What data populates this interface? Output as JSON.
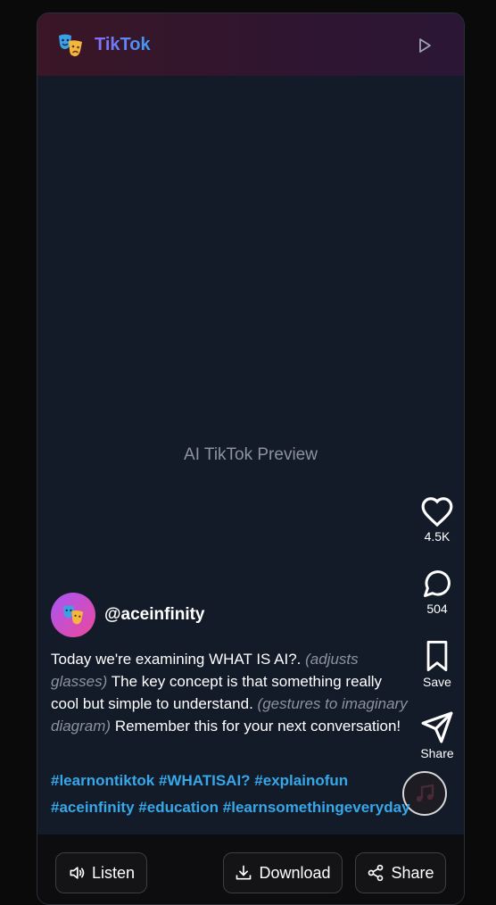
{
  "header": {
    "app_title": "TikTok",
    "logo_icon": "theater-masks-icon",
    "play_icon": "play-icon"
  },
  "video": {
    "placeholder": "AI TikTok Preview"
  },
  "actions": {
    "like_count": "4.5K",
    "comment_count": "504",
    "save_label": "Save",
    "share_label": "Share"
  },
  "author": {
    "username": "@aceinfinity"
  },
  "caption": {
    "part1": "Today we're examining WHAT IS AI?. ",
    "dir1": "(adjusts glasses)",
    "part2": " The key concept is that something really cool but simple to understand. ",
    "dir2": "(gestures to imaginary diagram)",
    "part3": " Remember this for your next conversation!"
  },
  "hashtags": [
    "#learnontiktok",
    "#WHATISAI?",
    "#explainofun",
    "#aceinfinity",
    "#education",
    "#learnsomethingeveryday"
  ],
  "bottom_bar": {
    "listen_label": "Listen",
    "download_label": "Download",
    "share_label": "Share"
  },
  "colors": {
    "accent_hashtag": "#36a7e8",
    "header_gradient_start": "#3a1626",
    "header_gradient_end": "#2b1636",
    "title_gradient_start": "#8b6cf6",
    "title_gradient_end": "#3b9bf5"
  }
}
